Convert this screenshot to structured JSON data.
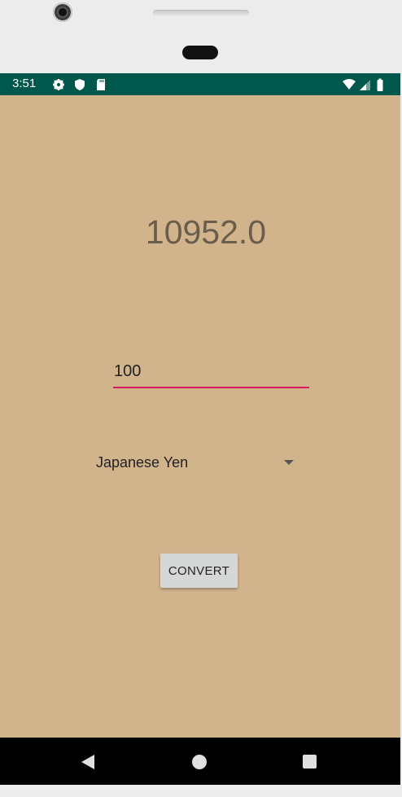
{
  "status_bar": {
    "time": "3:51",
    "left_icons": [
      "settings-icon",
      "shield-icon",
      "sd-card-icon"
    ],
    "right_icons": [
      "wifi-icon",
      "signal-icon",
      "battery-icon"
    ],
    "color": "#00574b"
  },
  "app": {
    "background_color": "#d2b48c",
    "result_text": "10952.0",
    "amount_input": {
      "value": "100"
    },
    "currency_spinner": {
      "selected": "Japanese Yen"
    },
    "convert_button": {
      "label": "CONVERT"
    }
  },
  "nav_bar": {
    "buttons": [
      "back-icon",
      "home-icon",
      "recents-icon"
    ]
  }
}
